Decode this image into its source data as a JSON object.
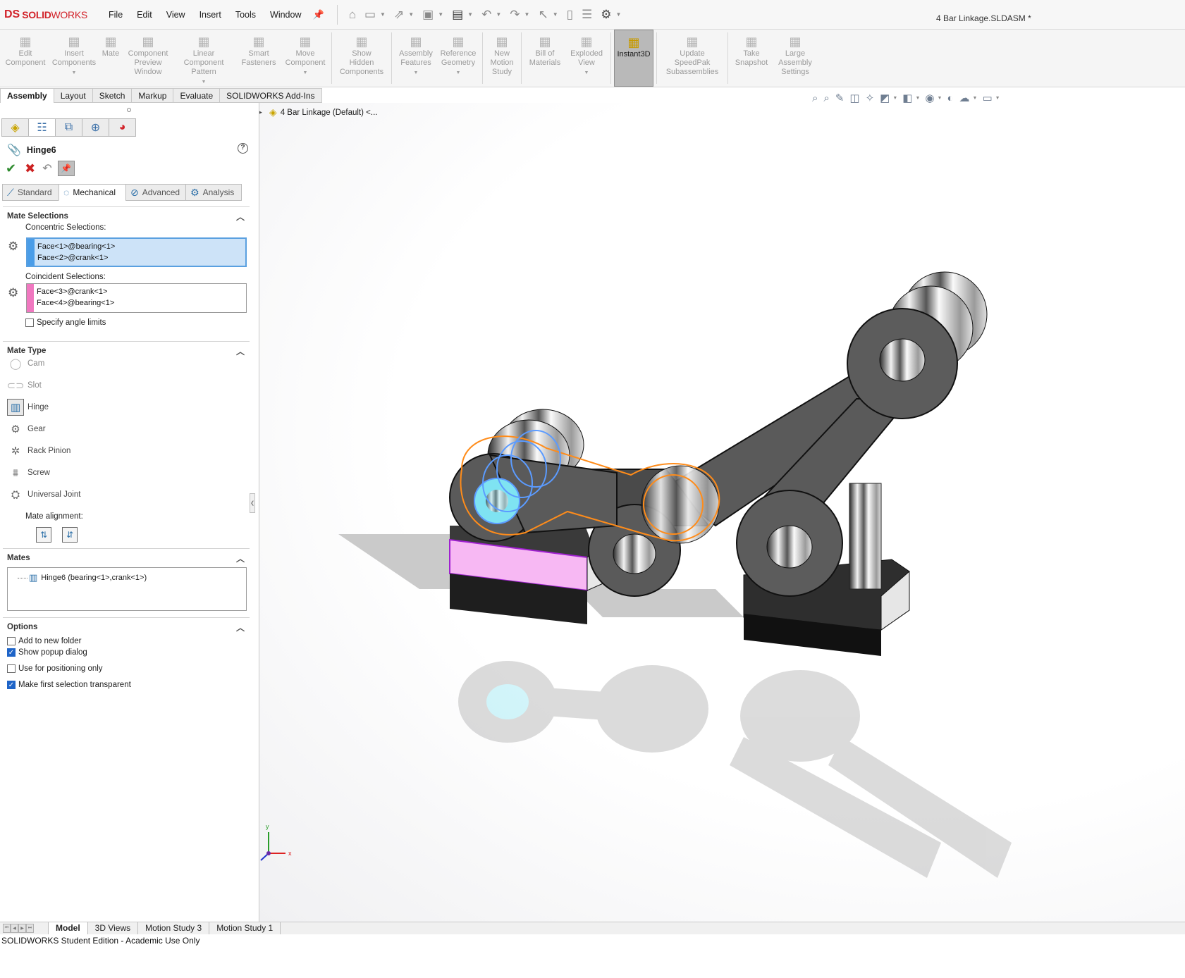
{
  "app": {
    "logo_mark": "DS",
    "logo_bold": "SOLID",
    "logo_light": "WORKS",
    "document_title": "4 Bar Linkage.SLDASM *"
  },
  "menu": [
    "File",
    "Edit",
    "View",
    "Insert",
    "Tools",
    "Window"
  ],
  "command_manager": [
    {
      "label1": "Edit",
      "label2": "Component",
      "label3": "",
      "icon": "edit-component-icon",
      "drop": false
    },
    {
      "label1": "Insert",
      "label2": "Components",
      "label3": "",
      "icon": "insert-components-icon",
      "drop": true
    },
    {
      "label1": "Mate",
      "label2": "",
      "label3": "",
      "icon": "mate-icon",
      "drop": false
    },
    {
      "label1": "Component",
      "label2": "Preview",
      "label3": "Window",
      "icon": "preview-window-icon",
      "drop": false
    },
    {
      "label1": "Linear Component",
      "label2": "Pattern",
      "label3": "",
      "icon": "linear-pattern-icon",
      "drop": true
    },
    {
      "label1": "Smart",
      "label2": "Fasteners",
      "label3": "",
      "icon": "smart-fasteners-icon",
      "drop": false
    },
    {
      "label1": "Move",
      "label2": "Component",
      "label3": "",
      "icon": "move-component-icon",
      "drop": true
    },
    {
      "label1": "Show",
      "label2": "Hidden",
      "label3": "Components",
      "icon": "show-hidden-icon",
      "drop": false
    },
    {
      "label1": "Assembly",
      "label2": "Features",
      "label3": "",
      "icon": "assembly-features-icon",
      "drop": true
    },
    {
      "label1": "Reference",
      "label2": "Geometry",
      "label3": "",
      "icon": "reference-geometry-icon",
      "drop": true
    },
    {
      "label1": "New",
      "label2": "Motion",
      "label3": "Study",
      "icon": "motion-study-icon",
      "drop": false
    },
    {
      "label1": "Bill of",
      "label2": "Materials",
      "label3": "",
      "icon": "bom-icon",
      "drop": false
    },
    {
      "label1": "Exploded",
      "label2": "View",
      "label3": "",
      "icon": "exploded-view-icon",
      "drop": true
    },
    {
      "label1": "Instant3D",
      "label2": "",
      "label3": "",
      "icon": "instant3d-icon",
      "drop": false
    },
    {
      "label1": "Update",
      "label2": "SpeedPak",
      "label3": "Subassemblies",
      "icon": "speedpak-icon",
      "drop": false
    },
    {
      "label1": "Take",
      "label2": "Snapshot",
      "label3": "",
      "icon": "snapshot-icon",
      "drop": false
    },
    {
      "label1": "Large",
      "label2": "Assembly",
      "label3": "Settings",
      "icon": "large-assembly-icon",
      "drop": false
    }
  ],
  "command_tabs": [
    "Assembly",
    "Layout",
    "Sketch",
    "Markup",
    "Evaluate",
    "SOLIDWORKS Add-Ins"
  ],
  "tree_flyout": "4 Bar Linkage (Default) <...",
  "property_manager": {
    "title": "Hinge6",
    "help_glyph": "?",
    "tabs": [
      "Standard",
      "Mechanical",
      "Advanced",
      "Analysis"
    ],
    "mate_selections": {
      "header": "Mate Selections",
      "concentric_label": "Concentric Selections:",
      "concentric": [
        "Face<1>@bearing<1>",
        "Face<2>@crank<1>"
      ],
      "coincident_label": "Coincident Selections:",
      "coincident": [
        "Face<3>@crank<1>",
        "Face<4>@bearing<1>"
      ],
      "angle_limits_label": "Specify angle limits",
      "angle_limits": false
    },
    "mate_type": {
      "header": "Mate Type",
      "items": [
        "Cam",
        "Slot",
        "Hinge",
        "Gear",
        "Rack Pinion",
        "Screw",
        "Universal Joint"
      ],
      "selected": "Hinge",
      "alignment_label": "Mate alignment:"
    },
    "mates": {
      "header": "Mates",
      "items": [
        "Hinge6 (bearing<1>,crank<1>)"
      ]
    },
    "options": {
      "header": "Options",
      "items": [
        {
          "label": "Add to new folder",
          "checked": false
        },
        {
          "label": "Show popup dialog",
          "checked": true
        },
        {
          "label": "Use for positioning only",
          "checked": false
        },
        {
          "label": "Make first selection transparent",
          "checked": true
        }
      ]
    }
  },
  "triad": {
    "x": "x",
    "y": "y"
  },
  "bottom_tabs": [
    "Model",
    "3D Views",
    "Motion Study 3",
    "Motion Study 1"
  ],
  "status_text": "SOLIDWORKS Student Edition - Academic Use Only",
  "colors": {
    "brand_red": "#d2232a",
    "concentric_swatch": "#4a9de8",
    "coincident_swatch": "#f078c0",
    "selection_orange": "#ff8c1a",
    "selection_blue": "#5b9bff",
    "selected_face": "#f7b8f3"
  }
}
